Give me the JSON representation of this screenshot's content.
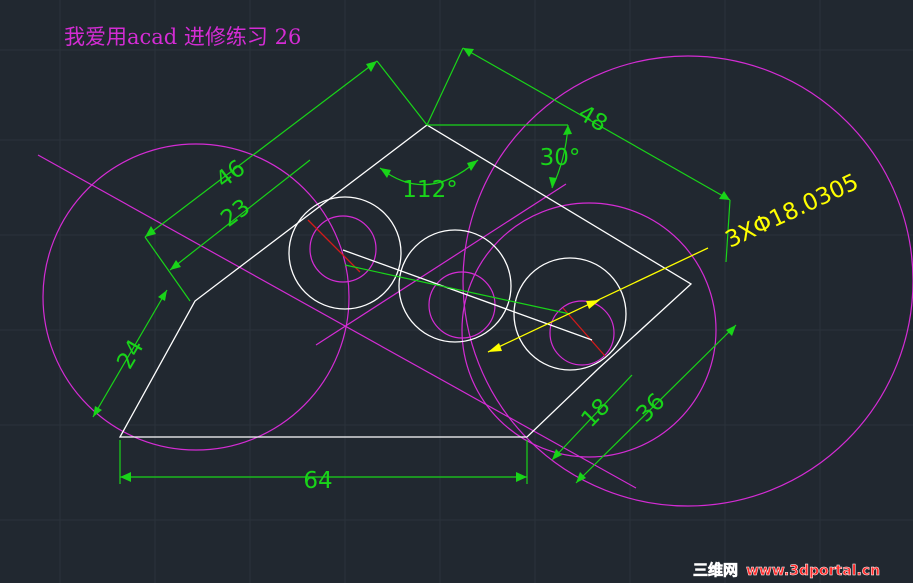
{
  "title": "我爱用acad  进修练习 26",
  "colors": {
    "background": "#212830",
    "grid": "#2a323b",
    "outline": "#ffffff",
    "construction": "#d42cd4",
    "dimension": "#19d419",
    "leader": "#ffff00",
    "centerline": "#d41a1a",
    "title": "#d42cd4"
  },
  "dimensions": {
    "d46": "46",
    "d48": "48",
    "d23": "23",
    "d24": "24",
    "d64": "64",
    "d18": "18",
    "d36": "36",
    "a112": "112°",
    "a30": "30°"
  },
  "annotation": "3XΦ18.0305",
  "watermark": {
    "brand": "三维网",
    "site": "www.3dportal.cn"
  }
}
